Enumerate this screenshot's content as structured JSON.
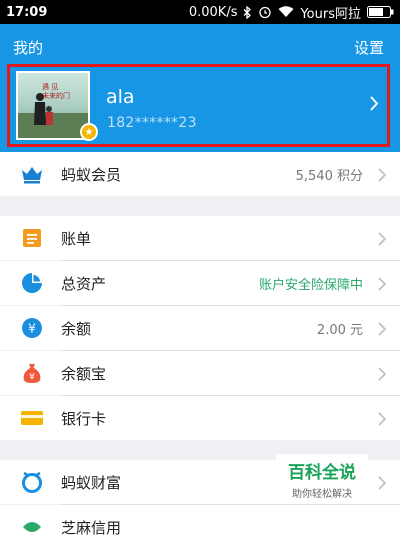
{
  "status_bar": {
    "time": "17:09",
    "speed": "0.00K/s",
    "carrier": "Yours阿拉"
  },
  "header": {
    "title": "我的",
    "settings_label": "设置"
  },
  "profile": {
    "name": "ala",
    "phone": "182******23",
    "avatar_text": "遇 见\n未来的门",
    "badge_icon": "star-icon"
  },
  "rows": [
    {
      "label": "蚂蚁会员",
      "value": "5,540 积分",
      "icon": "crown-icon",
      "color": "#1a7fd1"
    },
    {
      "label": "账单",
      "value": "",
      "icon": "bill-icon",
      "color": "#f39a1f"
    },
    {
      "label": "总资产",
      "value": "账户安全险保障中",
      "icon": "pie-chart-icon",
      "color": "#1a8fe0"
    },
    {
      "label": "余额",
      "value": "2.00 元",
      "icon": "yuan-coin-icon",
      "color": "#1a8fe0"
    },
    {
      "label": "余额宝",
      "value": "",
      "icon": "money-bag-icon",
      "color": "#ef5a3c"
    },
    {
      "label": "银行卡",
      "value": "",
      "icon": "bank-card-icon",
      "color": "#f5b400"
    },
    {
      "label": "蚂蚁财富",
      "value": "",
      "icon": "wealth-icon",
      "color": "#1a8fe0"
    },
    {
      "label": "芝麻信用",
      "value": "",
      "icon": "sesame-icon",
      "color": "#2aa96b"
    }
  ],
  "watermark": {
    "title": "百科全说",
    "subtitle": "助你轻松解决"
  }
}
